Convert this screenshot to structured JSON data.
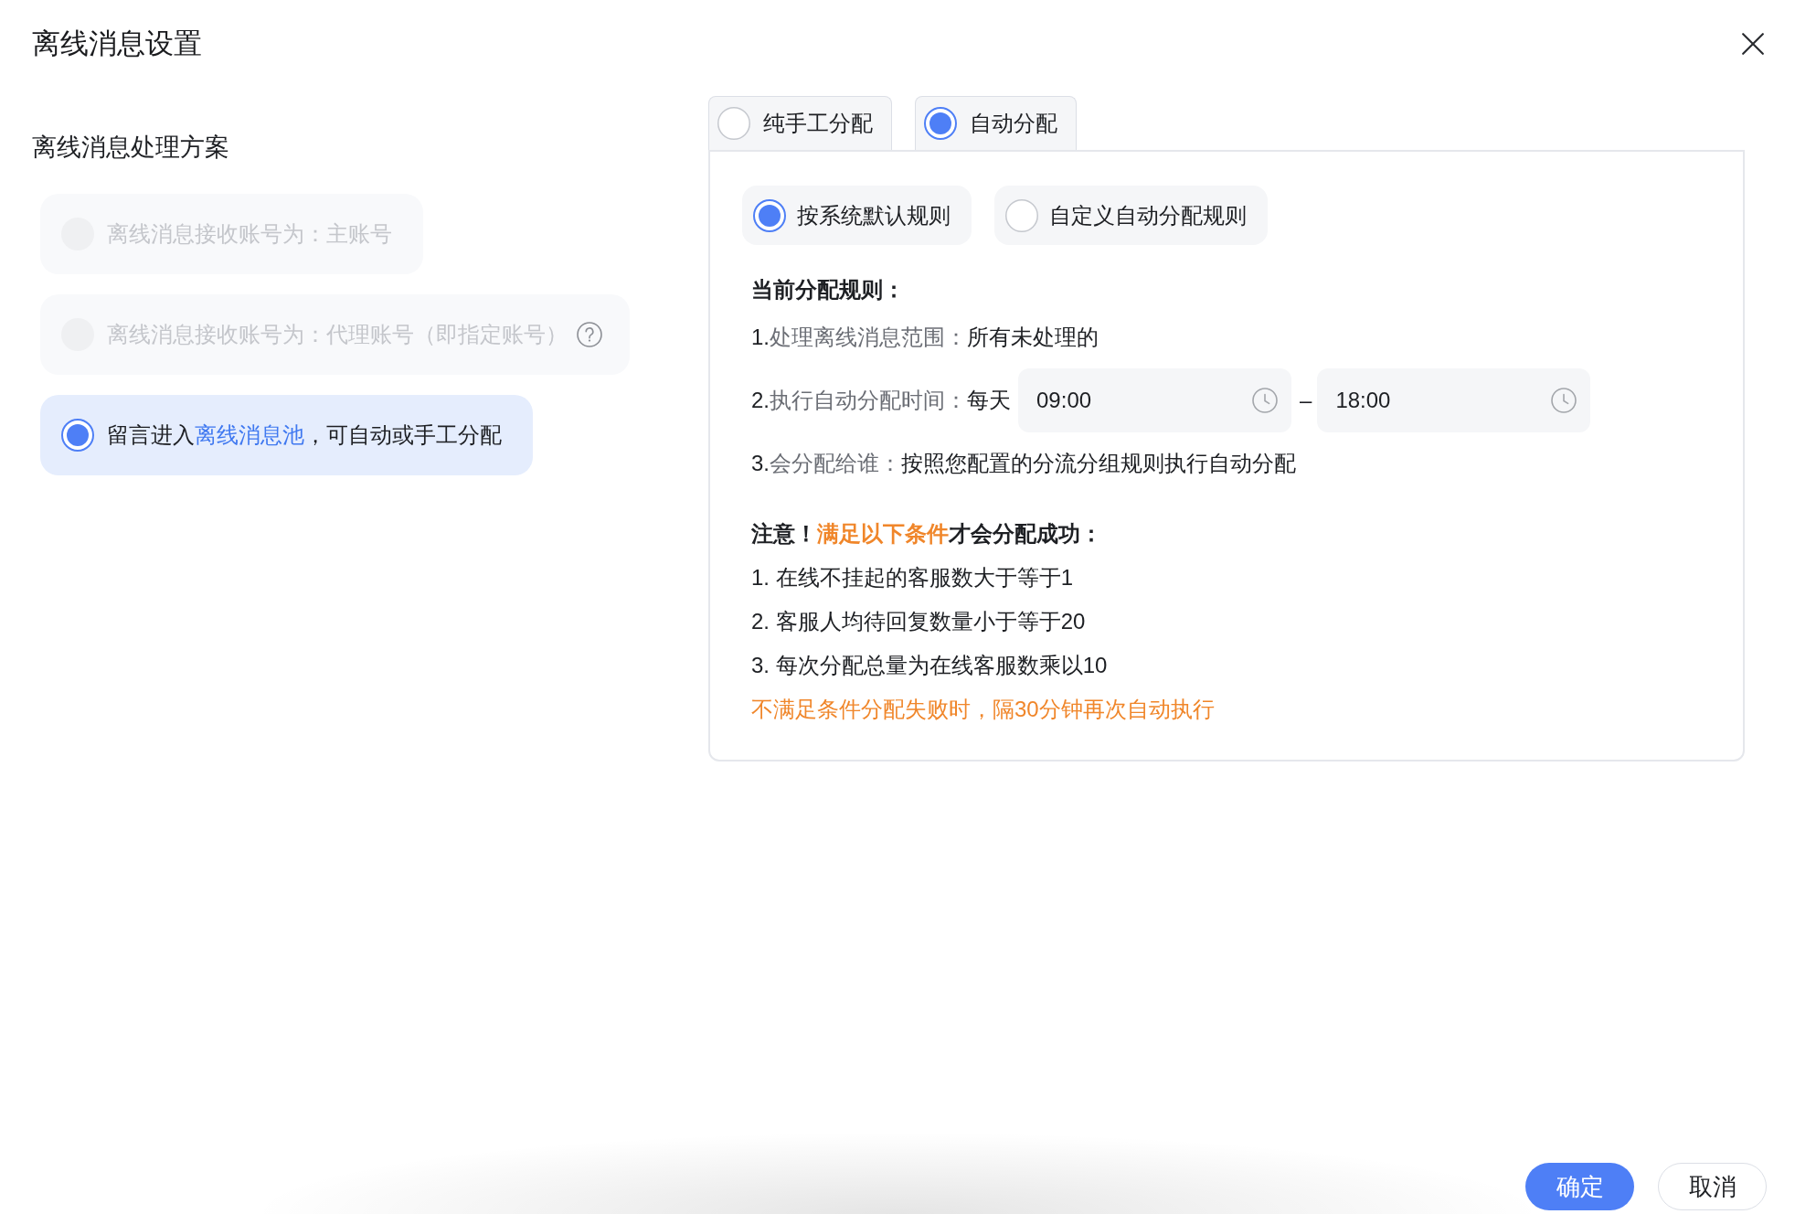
{
  "dialog": {
    "title": "离线消息设置"
  },
  "scheme": {
    "label": "离线消息处理方案",
    "options": [
      {
        "parts": [
          {
            "kind": "text",
            "text": "离线消息接收账号为：主账号"
          }
        ],
        "selected": false,
        "disabled": true,
        "help": false
      },
      {
        "parts": [
          {
            "kind": "text",
            "text": "离线消息接收账号为：代理账号（即指定账号）"
          }
        ],
        "selected": false,
        "disabled": true,
        "help": true
      },
      {
        "parts": [
          {
            "kind": "text",
            "text": "留言进入"
          },
          {
            "kind": "link",
            "text": "离线消息池"
          },
          {
            "kind": "text",
            "text": "，可自动或手工分配"
          }
        ],
        "selected": true,
        "disabled": false,
        "help": false
      }
    ]
  },
  "tabs": [
    {
      "label": "纯手工分配",
      "selected": false
    },
    {
      "label": "自动分配",
      "selected": true
    }
  ],
  "rule_modes": [
    {
      "label": "按系统默认规则",
      "selected": true
    },
    {
      "label": "自定义自动分配规则",
      "selected": false
    }
  ],
  "current_rule": {
    "heading": "当前分配规则：",
    "items": [
      {
        "kind": "text",
        "number": "1.",
        "label": "处理离线消息范围：",
        "value": "所有未处理的"
      },
      {
        "kind": "time_range",
        "number": "2.",
        "label": "执行自动分配时间：",
        "value": "每天",
        "start": "09:00",
        "separator": "–",
        "end": "18:00"
      },
      {
        "kind": "text",
        "number": "3.",
        "label": "会分配给谁：",
        "value": "按照您配置的分流分组规则执行自动分配"
      }
    ]
  },
  "notice": {
    "heading_before": "注意！",
    "highlight": "满足以下条件",
    "heading_after": "才会分配成功：",
    "conditions": [
      "1. 在线不挂起的客服数大于等于1",
      "2. 客服人均待回复数量小于等于20",
      "3. 每次分配总量为在线客服数乘以10"
    ],
    "warning": "不满足条件分配失败时，隔30分钟再次自动执行"
  },
  "buttons": [
    {
      "label": "确定",
      "kind": "primary"
    },
    {
      "label": "取消",
      "kind": "secondary"
    }
  ]
}
